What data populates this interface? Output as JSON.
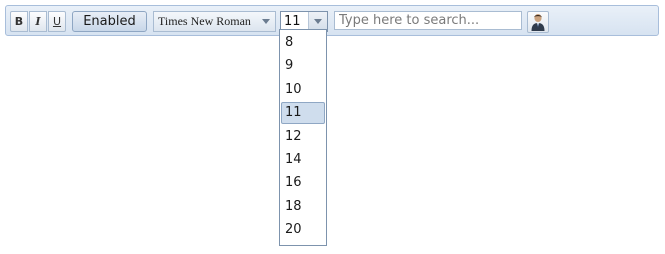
{
  "toolbar": {
    "format_buttons": {
      "bold": "B",
      "italic": "I",
      "underline": "U"
    },
    "enabled_button": "Enabled",
    "font_family": {
      "selected": "Times New Roman"
    },
    "font_size": {
      "selected": "11",
      "options": [
        "8",
        "9",
        "10",
        "11",
        "12",
        "14",
        "16",
        "18",
        "20"
      ]
    },
    "search": {
      "placeholder": "Type here to search...",
      "value": ""
    },
    "icons": {
      "font_caret": "chevron-down-icon",
      "size_caret": "chevron-down-icon",
      "user": "user-icon"
    }
  }
}
